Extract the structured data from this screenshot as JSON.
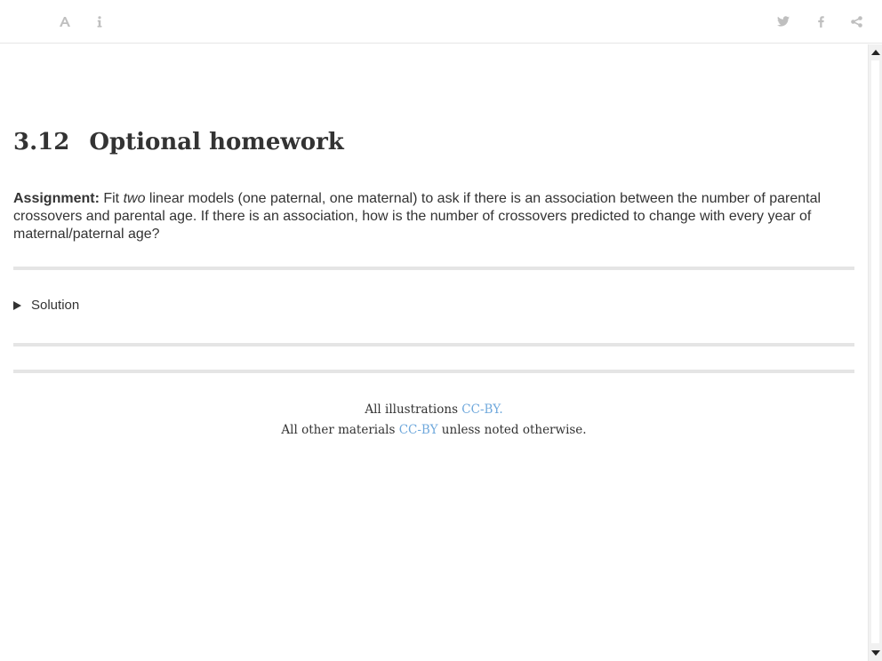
{
  "toolbar": {
    "left_icons": [
      "font-settings-icon",
      "info-icon"
    ],
    "right_icons": [
      "twitter-icon",
      "facebook-icon",
      "share-icon"
    ],
    "icon_color": "#bfbfbf"
  },
  "section": {
    "number": "3.12",
    "title": "Optional homework"
  },
  "assignment": {
    "label": "Assignment:",
    "text_before": " Fit ",
    "emphasis": "two",
    "text_after": " linear models (one paternal, one maternal) to ask if there is an association between the number of parental crossovers and parental age. If there is an association, how is the number of crossovers predicted to change with every year of maternal/paternal age?"
  },
  "solution": {
    "summary": "Solution",
    "expanded": false
  },
  "footer": {
    "line1_prefix": "All illustrations ",
    "line1_link": "CC-BY.",
    "line2_prefix": "All other materials ",
    "line2_link": "CC-BY",
    "line2_suffix": " unless noted otherwise.",
    "link_color": "#6fa8dc"
  }
}
